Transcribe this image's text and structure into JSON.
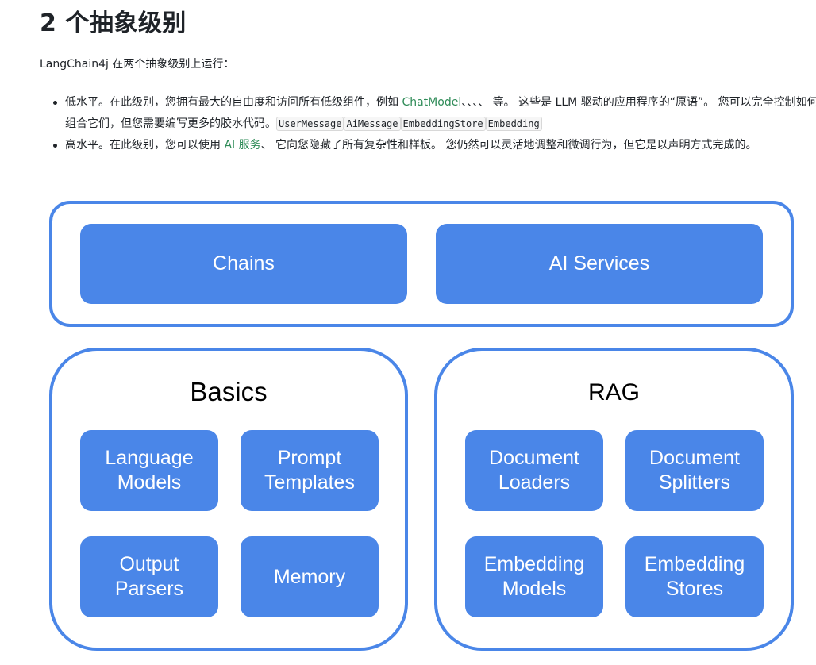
{
  "heading": "2 个抽象级别",
  "intro": "LangChain4j 在两个抽象级别上运行：",
  "low_level": {
    "text_a": "低水平。在此级别，您拥有最大的自由度和访问所有低级组件，例如 ",
    "link": "ChatModel",
    "text_b": "、、、、 等。 这些是 LLM 驱动的应用程序的“原语”。 您可以完全控制如何组合它们，但您需要编写更多的胶水代码。",
    "codes": [
      "UserMessage",
      "AiMessage",
      "EmbeddingStore",
      "Embedding"
    ]
  },
  "high_level": {
    "text_a": "高水平。在此级别，您可以使用 ",
    "link": "AI 服务",
    "text_b": "、 它向您隐藏了所有复杂性和样板。 您仍然可以灵活地调整和微调行为，但它是以声明方式完成的。"
  },
  "diagram": {
    "top_boxes": [
      "Chains",
      "AI Services"
    ],
    "basics": {
      "title": "Basics",
      "boxes": [
        "Language\nModels",
        "Prompt\nTemplates",
        "Output\nParsers",
        "Memory"
      ]
    },
    "rag": {
      "title": "RAG",
      "boxes": [
        "Document\nLoaders",
        "Document\nSplitters",
        "Embedding\nModels",
        "Embedding\nStores"
      ]
    },
    "colors": {
      "accent": "#4a86e8",
      "box_text": "#ffffff",
      "link": "#2e8b57"
    }
  }
}
